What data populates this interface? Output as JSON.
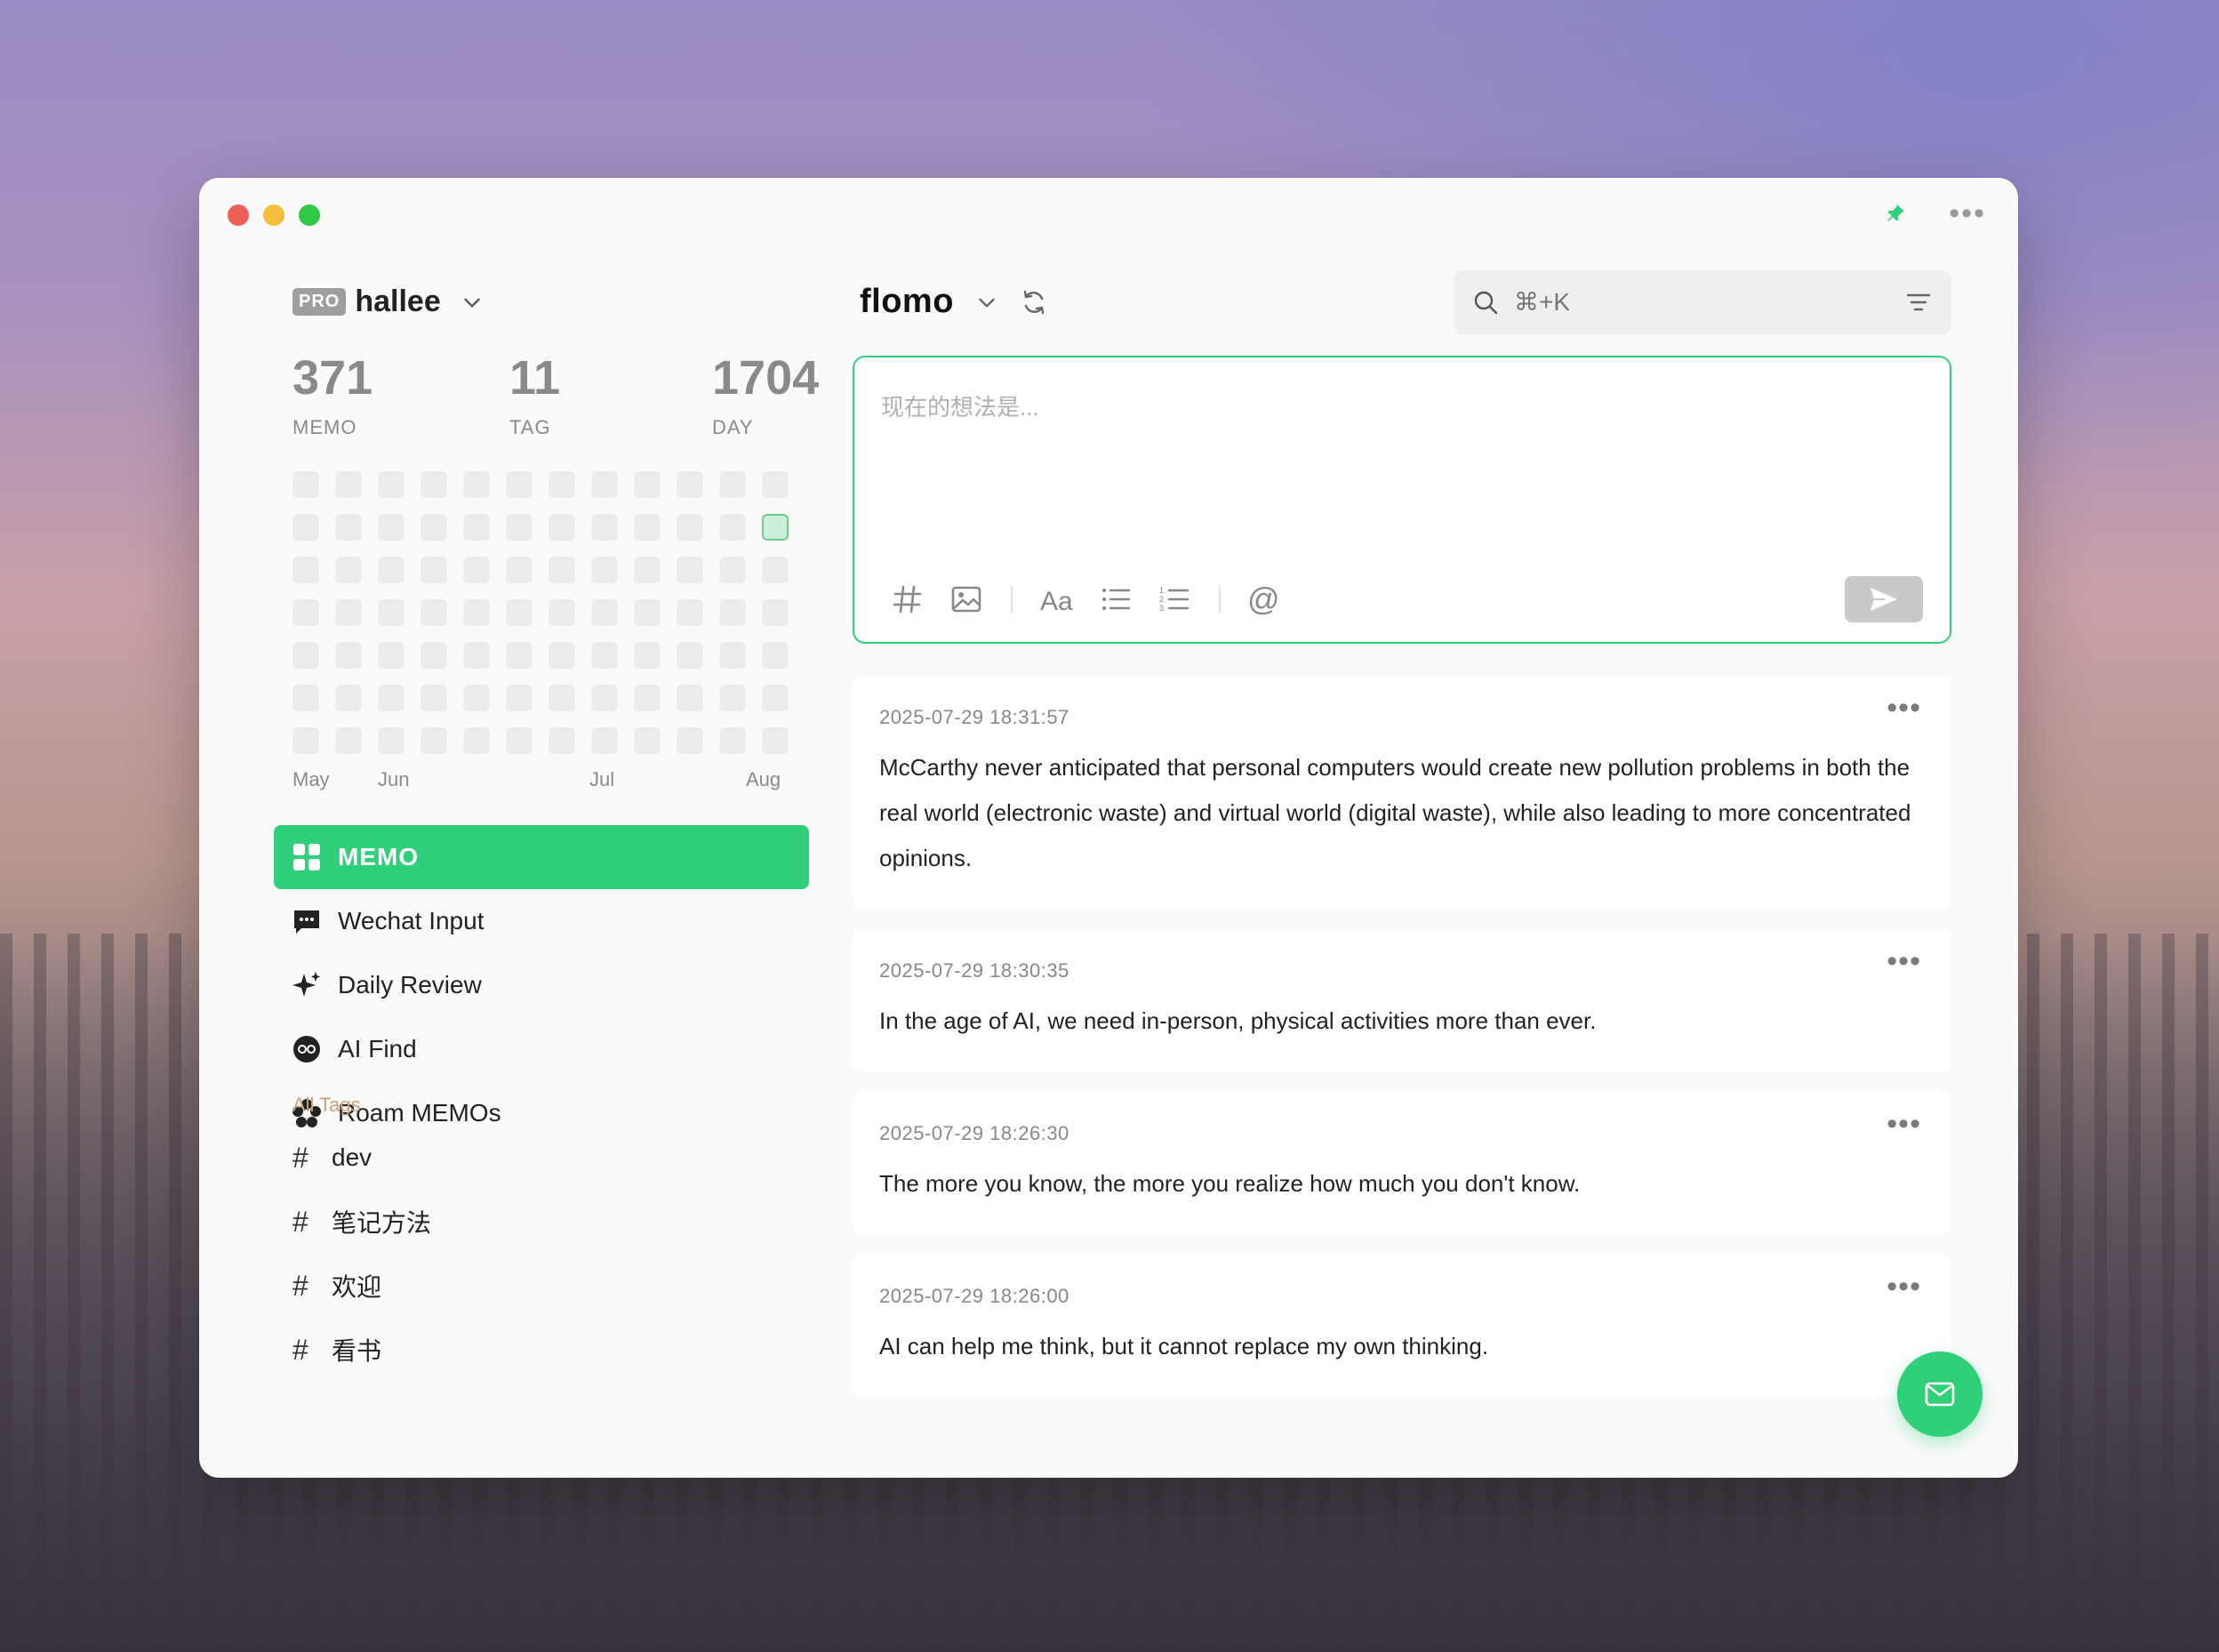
{
  "app": {
    "brand": "flomo",
    "colors": {
      "accent": "#30cf79",
      "tag_title": "#c7a37a"
    }
  },
  "user": {
    "badge": "PRO",
    "name": "hallee"
  },
  "stats": [
    {
      "value": "371",
      "label": "MEMO"
    },
    {
      "value": "11",
      "label": "TAG"
    },
    {
      "value": "1704",
      "label": "DAY"
    }
  ],
  "heatmap": {
    "months": [
      "May",
      "Jun",
      "Jul",
      "Aug"
    ]
  },
  "nav": {
    "memo": "MEMO",
    "wechat": "Wechat Input",
    "daily_review": "Daily Review",
    "ai_find": "AI Find",
    "roam": "Roam MEMOs"
  },
  "tags": {
    "title": "All Tags",
    "items": [
      "dev",
      "笔记方法",
      "欢迎",
      "看书"
    ]
  },
  "search": {
    "placeholder": "⌘+K"
  },
  "editor": {
    "placeholder": "现在的想法是..."
  },
  "memos": [
    {
      "time": "2025-07-29 18:31:57",
      "content": "McCarthy never anticipated that personal computers would create new pollution problems in both the real world (electronic waste) and virtual world (digital waste), while also leading to more concentrated opinions."
    },
    {
      "time": "2025-07-29 18:30:35",
      "content": "In the age of AI, we need in-person, physical activities more than ever."
    },
    {
      "time": "2025-07-29 18:26:30",
      "content": "The more you know, the more you realize how much you don't know."
    },
    {
      "time": "2025-07-29 18:26:00",
      "content": "AI can help me think, but it cannot replace my own thinking."
    }
  ]
}
